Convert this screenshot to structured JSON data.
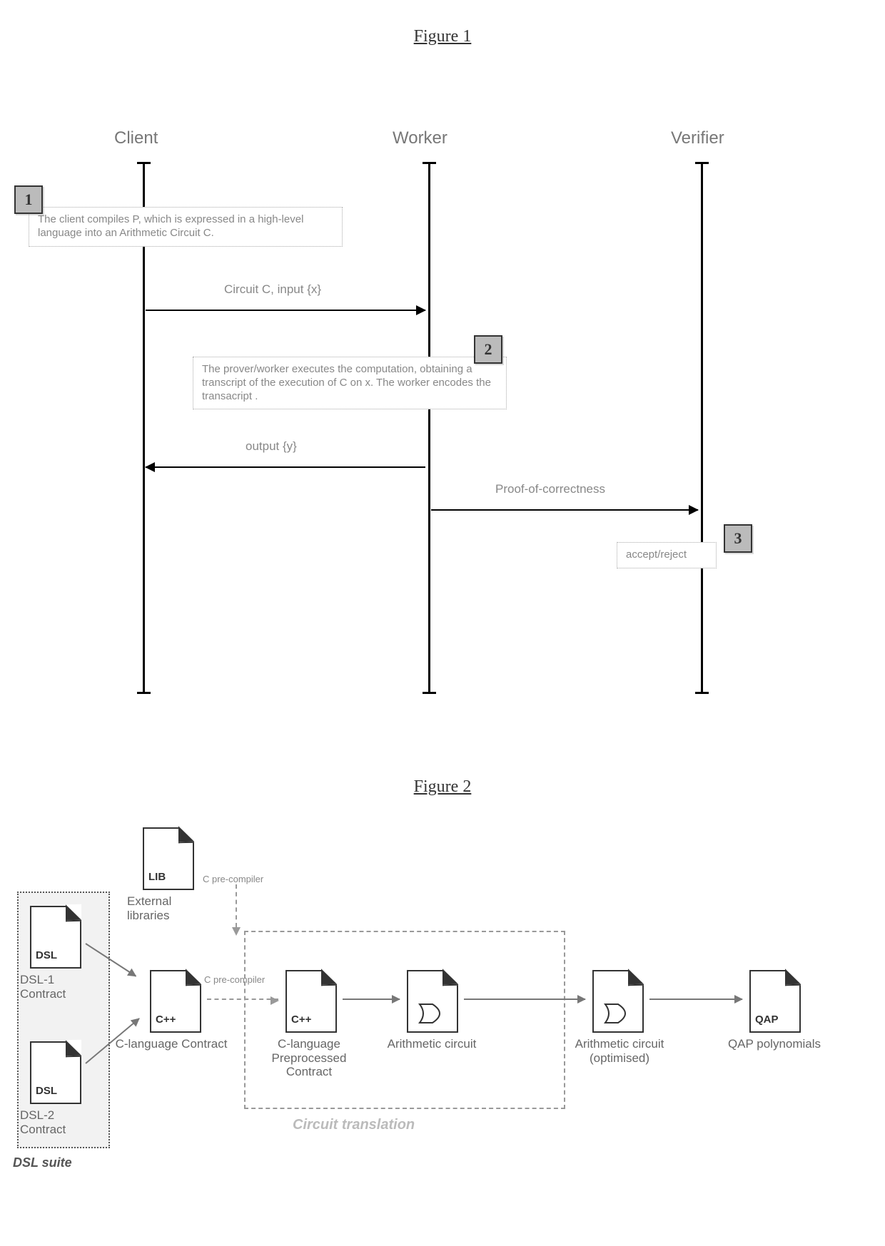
{
  "fig1": {
    "title": "Figure 1",
    "roles": {
      "client": "Client",
      "worker": "Worker",
      "verifier": "Verifier"
    },
    "steps": {
      "one": {
        "num": "1",
        "text": "The client compiles P, which is expressed in a high-level language into an Arithmetic Circuit C."
      },
      "two": {
        "num": "2",
        "text": "The prover/worker executes the computation, obtaining a transcript of the execution of C on x. The worker encodes the transacript ."
      },
      "three": {
        "num": "3",
        "text": "accept/reject"
      }
    },
    "msgs": {
      "m1": "Circuit C, input {x}",
      "m2": "output {y}",
      "m3": "Proof-of-correctness"
    }
  },
  "fig2": {
    "title": "Figure 2",
    "dslSuiteLabel": "DSL suite",
    "circuitLabel": "Circuit translation",
    "precompiler": "C pre-compiler",
    "docs": {
      "lib": {
        "tag": "LIB",
        "caption": "External libraries"
      },
      "dsl1": {
        "tag": "DSL",
        "caption": "DSL-1 Contract"
      },
      "dsl2": {
        "tag": "DSL",
        "caption": "DSL-2 Contract"
      },
      "cpp1": {
        "tag": "C++",
        "caption": "C-language Contract"
      },
      "cpp2": {
        "tag": "C++",
        "caption": "C-language Preprocessed Contract"
      },
      "ac1": {
        "tag": "",
        "caption": "Arithmetic circuit"
      },
      "ac2": {
        "tag": "",
        "caption": "Arithmetic circuit (optimised)"
      },
      "qap": {
        "tag": "QAP",
        "caption": "QAP polynomials"
      }
    }
  }
}
